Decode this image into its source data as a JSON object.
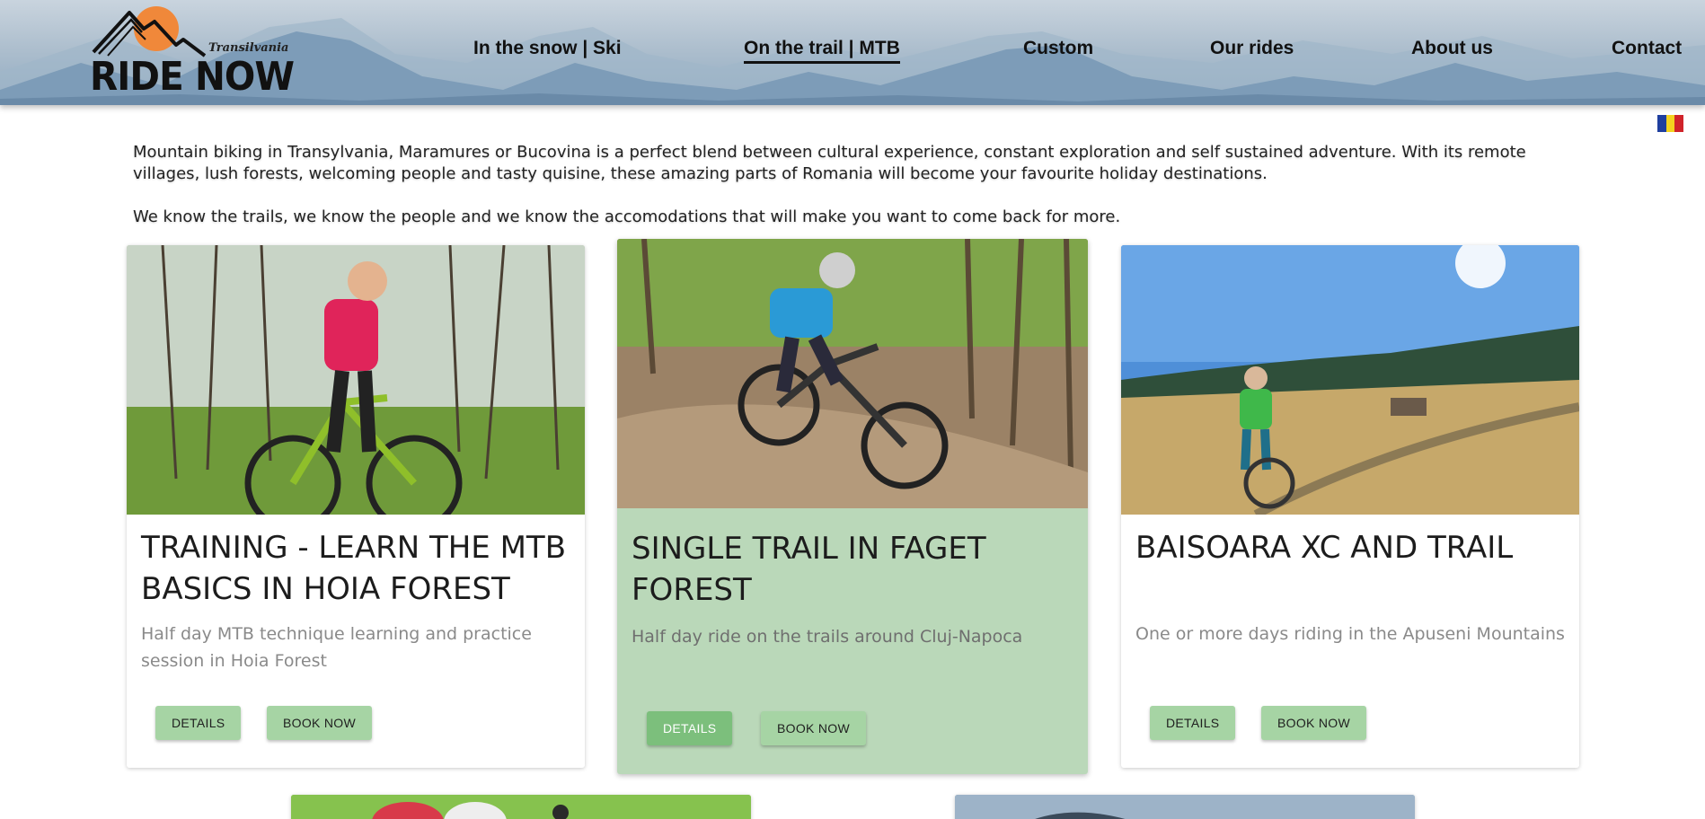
{
  "brand": {
    "name": "RIDE NOW",
    "region": "Transilvania",
    "sun_color": "#f0883a"
  },
  "nav": {
    "items": [
      {
        "label": "In the snow | Ski",
        "active": false
      },
      {
        "label": "On the trail | MTB",
        "active": true
      },
      {
        "label": "Custom",
        "active": false
      },
      {
        "label": "Our rides",
        "active": false
      },
      {
        "label": "About us",
        "active": false
      },
      {
        "label": "Contact",
        "active": false
      }
    ]
  },
  "language_flag": {
    "icon": "romania-flag-icon",
    "colors": [
      "#1f3f9f",
      "#f4d21f",
      "#d0232a"
    ]
  },
  "intro": {
    "paragraph1": "Mountain biking in Transylvania, Maramures or Bucovina is a perfect blend between cultural experience, constant exploration and self sustained adventure. With its remote villages, lush forests, welcoming people and tasty quisine, these amazing parts of Romania will become your favourite holiday destinations.",
    "paragraph2": "We know the trails, we know the people and we know the accomodations that will make you want to come back for more."
  },
  "cards": [
    {
      "title": "TRAINING - LEARN THE MTB BASICS IN HOIA FOREST",
      "description": "Half day MTB technique learning and practice session in Hoia Forest",
      "details_label": "DETAILS",
      "book_label": "BOOK NOW",
      "highlighted": false
    },
    {
      "title": "SINGLE TRAIL IN FAGET FOREST",
      "description": "Half day ride on the trails around Cluj-Napoca",
      "details_label": "DETAILS",
      "book_label": "BOOK NOW",
      "highlighted": true
    },
    {
      "title": "BAISOARA XC AND TRAIL",
      "description": "One or more days riding in the Apuseni Mountains",
      "details_label": "DETAILS",
      "book_label": "BOOK NOW",
      "highlighted": false
    }
  ],
  "colors": {
    "button": "#a6d4a4",
    "button_active": "#7cbf7c",
    "highlight_card": "#bad8b9"
  }
}
